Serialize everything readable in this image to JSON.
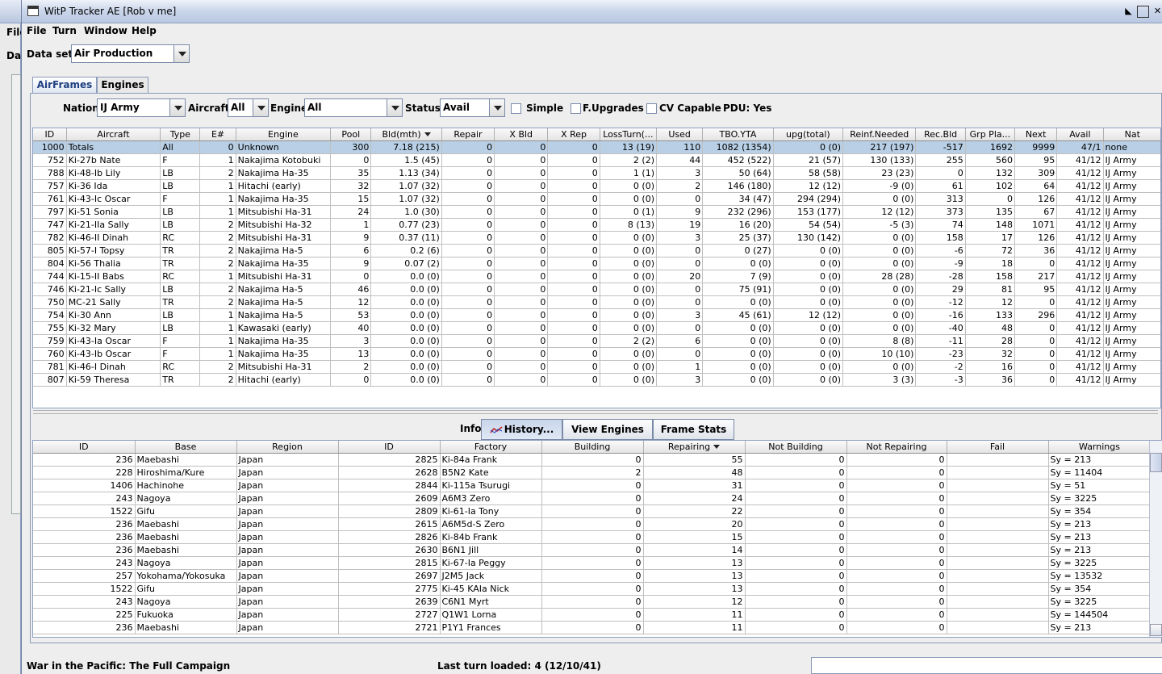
{
  "bg": {
    "menu": "File",
    "dataset": "Da"
  },
  "window": {
    "title": "WitP Tracker AE [Rob v me]"
  },
  "menu": [
    "File",
    "Turn",
    "Window",
    "Help"
  ],
  "dataset": {
    "label": "Data set:",
    "value": "Air Production"
  },
  "tabs": [
    "AirFrames",
    "Engines"
  ],
  "filters": {
    "nation_label": "Nation:",
    "nation": "IJ Army",
    "aircraft_label": "Aircraft:",
    "aircraft": "All",
    "engine_label": "Engine:",
    "engine": "All",
    "status_label": "Status:",
    "status": "Avail",
    "simple": "Simple",
    "fupgrades": "F.Upgrades",
    "cv": "CV Capable",
    "pdu": "PDU: Yes"
  },
  "frames": {
    "columns": [
      "ID",
      "Aircraft",
      "Type",
      "E#",
      "Engine",
      "Pool",
      "Bld(mth)",
      "Repair",
      "X Bld",
      "X Rep",
      "LossTurn(...",
      "Used",
      "TBO.YTA",
      "upg(total)",
      "Reinf.Needed",
      "Rec.Bld",
      "Grp Pla...",
      "Next",
      "Avail",
      "Nat"
    ],
    "rows": [
      [
        "1000",
        "Totals",
        "All",
        "0",
        "Unknown",
        "300",
        "7.18 (215)",
        "0",
        "0",
        "0",
        "13 (19)",
        "110",
        "1082 (1354)",
        "0 (0)",
        "217 (197)",
        "-517",
        "1692",
        "9999",
        "47/1",
        "none"
      ],
      [
        "752",
        "Ki-27b Nate",
        "F",
        "1",
        "Nakajima Kotobuki",
        "0",
        "1.5 (45)",
        "0",
        "0",
        "0",
        "2 (2)",
        "44",
        "452 (522)",
        "21 (57)",
        "130 (133)",
        "255",
        "560",
        "95",
        "41/12",
        "IJ Army"
      ],
      [
        "788",
        "Ki-48-Ib Lily",
        "LB",
        "2",
        "Nakajima Ha-35",
        "35",
        "1.13 (34)",
        "0",
        "0",
        "0",
        "1 (1)",
        "3",
        "50 (64)",
        "58 (58)",
        "23 (23)",
        "0",
        "132",
        "309",
        "41/12",
        "IJ Army"
      ],
      [
        "757",
        "Ki-36 Ida",
        "LB",
        "1",
        "Hitachi (early)",
        "32",
        "1.07 (32)",
        "0",
        "0",
        "0",
        "0 (0)",
        "2",
        "146 (180)",
        "12 (12)",
        "-9 (0)",
        "61",
        "102",
        "64",
        "41/12",
        "IJ Army"
      ],
      [
        "761",
        "Ki-43-Ic Oscar",
        "F",
        "1",
        "Nakajima Ha-35",
        "15",
        "1.07 (32)",
        "0",
        "0",
        "0",
        "0 (0)",
        "0",
        "34 (47)",
        "294 (294)",
        "0 (0)",
        "313",
        "0",
        "126",
        "41/12",
        "IJ Army"
      ],
      [
        "797",
        "Ki-51 Sonia",
        "LB",
        "1",
        "Mitsubishi Ha-31",
        "24",
        "1.0 (30)",
        "0",
        "0",
        "0",
        "0 (1)",
        "9",
        "232 (296)",
        "153 (177)",
        "12 (12)",
        "373",
        "135",
        "67",
        "41/12",
        "IJ Army"
      ],
      [
        "747",
        "Ki-21-IIa Sally",
        "LB",
        "2",
        "Mitsubishi Ha-32",
        "1",
        "0.77 (23)",
        "0",
        "0",
        "0",
        "8 (13)",
        "19",
        "16 (20)",
        "54 (54)",
        "-5 (3)",
        "74",
        "148",
        "1071",
        "41/12",
        "IJ Army"
      ],
      [
        "782",
        "Ki-46-II Dinah",
        "RC",
        "2",
        "Mitsubishi Ha-31",
        "9",
        "0.37 (11)",
        "0",
        "0",
        "0",
        "0 (0)",
        "3",
        "25 (37)",
        "130 (142)",
        "0 (0)",
        "158",
        "17",
        "126",
        "41/12",
        "IJ Army"
      ],
      [
        "805",
        "Ki-57-I Topsy",
        "TR",
        "2",
        "Nakajima Ha-5",
        "6",
        "0.2 (6)",
        "0",
        "0",
        "0",
        "0 (0)",
        "0",
        "0 (27)",
        "0 (0)",
        "0 (0)",
        "-6",
        "72",
        "36",
        "41/12",
        "IJ Army"
      ],
      [
        "804",
        "Ki-56 Thalia",
        "TR",
        "2",
        "Nakajima Ha-35",
        "9",
        "0.07 (2)",
        "0",
        "0",
        "0",
        "0 (0)",
        "0",
        "0 (0)",
        "0 (0)",
        "0 (0)",
        "-9",
        "18",
        "0",
        "41/12",
        "IJ Army"
      ],
      [
        "744",
        "Ki-15-II Babs",
        "RC",
        "1",
        "Mitsubishi Ha-31",
        "0",
        "0.0 (0)",
        "0",
        "0",
        "0",
        "0 (0)",
        "20",
        "7 (9)",
        "0 (0)",
        "28 (28)",
        "-28",
        "158",
        "217",
        "41/12",
        "IJ Army"
      ],
      [
        "746",
        "Ki-21-Ic Sally",
        "LB",
        "2",
        "Nakajima Ha-5",
        "46",
        "0.0 (0)",
        "0",
        "0",
        "0",
        "0 (0)",
        "0",
        "75 (91)",
        "0 (0)",
        "0 (0)",
        "29",
        "81",
        "95",
        "41/12",
        "IJ Army"
      ],
      [
        "750",
        "MC-21 Sally",
        "TR",
        "2",
        "Nakajima Ha-5",
        "12",
        "0.0 (0)",
        "0",
        "0",
        "0",
        "0 (0)",
        "0",
        "0 (0)",
        "0 (0)",
        "0 (0)",
        "-12",
        "12",
        "0",
        "41/12",
        "IJ Army"
      ],
      [
        "754",
        "Ki-30 Ann",
        "LB",
        "1",
        "Nakajima Ha-5",
        "53",
        "0.0 (0)",
        "0",
        "0",
        "0",
        "0 (0)",
        "3",
        "45 (61)",
        "12 (12)",
        "0 (0)",
        "-16",
        "133",
        "296",
        "41/12",
        "IJ Army"
      ],
      [
        "755",
        "Ki-32 Mary",
        "LB",
        "1",
        "Kawasaki (early)",
        "40",
        "0.0 (0)",
        "0",
        "0",
        "0",
        "0 (0)",
        "0",
        "0 (0)",
        "0 (0)",
        "0 (0)",
        "-40",
        "48",
        "0",
        "41/12",
        "IJ Army"
      ],
      [
        "759",
        "Ki-43-Ia Oscar",
        "F",
        "1",
        "Nakajima Ha-35",
        "3",
        "0.0 (0)",
        "0",
        "0",
        "0",
        "2 (2)",
        "6",
        "0 (0)",
        "0 (0)",
        "8 (8)",
        "-11",
        "28",
        "0",
        "41/12",
        "IJ Army"
      ],
      [
        "760",
        "Ki-43-Ib Oscar",
        "F",
        "1",
        "Nakajima Ha-35",
        "13",
        "0.0 (0)",
        "0",
        "0",
        "0",
        "0 (0)",
        "0",
        "0 (0)",
        "0 (0)",
        "10 (10)",
        "-23",
        "32",
        "0",
        "41/12",
        "IJ Army"
      ],
      [
        "781",
        "Ki-46-I Dinah",
        "RC",
        "2",
        "Mitsubishi Ha-31",
        "2",
        "0.0 (0)",
        "0",
        "0",
        "0",
        "0 (0)",
        "1",
        "0 (0)",
        "0 (0)",
        "0 (0)",
        "-2",
        "16",
        "0",
        "41/12",
        "IJ Army"
      ],
      [
        "807",
        "Ki-59 Theresa",
        "TR",
        "2",
        "Hitachi (early)",
        "0",
        "0.0 (0)",
        "0",
        "0",
        "0",
        "0 (0)",
        "3",
        "0 (0)",
        "0 (0)",
        "3 (3)",
        "-3",
        "36",
        "0",
        "41/12",
        "IJ Army"
      ]
    ]
  },
  "info": {
    "label": "Info:",
    "history": "History...",
    "engines": "View Engines",
    "stats": "Frame Stats"
  },
  "factories": {
    "columns": [
      "ID",
      "Base",
      "Region",
      "ID",
      "Factory",
      "Building",
      "Repairing",
      "Not Building",
      "Not Repairing",
      "Fail",
      "Warnings"
    ],
    "rows": [
      [
        "236",
        "Maebashi",
        "Japan",
        "2825",
        "Ki-84a Frank",
        "0",
        "55",
        "0",
        "0",
        "",
        "Sy = 213"
      ],
      [
        "228",
        "Hiroshima/Kure",
        "Japan",
        "2628",
        "B5N2 Kate",
        "2",
        "48",
        "0",
        "0",
        "",
        "Sy = 11404"
      ],
      [
        "1406",
        "Hachinohe",
        "Japan",
        "2844",
        "Ki-115a Tsurugi",
        "0",
        "31",
        "0",
        "0",
        "",
        "Sy = 51"
      ],
      [
        "243",
        "Nagoya",
        "Japan",
        "2609",
        "A6M3 Zero",
        "0",
        "24",
        "0",
        "0",
        "",
        "Sy = 3225"
      ],
      [
        "1522",
        "Gifu",
        "Japan",
        "2809",
        "Ki-61-Ia Tony",
        "0",
        "22",
        "0",
        "0",
        "",
        "Sy = 354"
      ],
      [
        "236",
        "Maebashi",
        "Japan",
        "2615",
        "A6M5d-S Zero",
        "0",
        "20",
        "0",
        "0",
        "",
        "Sy = 213"
      ],
      [
        "236",
        "Maebashi",
        "Japan",
        "2826",
        "Ki-84b Frank",
        "0",
        "15",
        "0",
        "0",
        "",
        "Sy = 213"
      ],
      [
        "236",
        "Maebashi",
        "Japan",
        "2630",
        "B6N1 Jill",
        "0",
        "14",
        "0",
        "0",
        "",
        "Sy = 213"
      ],
      [
        "243",
        "Nagoya",
        "Japan",
        "2815",
        "Ki-67-Ia Peggy",
        "0",
        "13",
        "0",
        "0",
        "",
        "Sy = 3225"
      ],
      [
        "257",
        "Yokohama/Yokosuka",
        "Japan",
        "2697",
        "J2M5 Jack",
        "0",
        "13",
        "0",
        "0",
        "",
        "Sy = 13532"
      ],
      [
        "1522",
        "Gifu",
        "Japan",
        "2775",
        "Ki-45 KAIa Nick",
        "0",
        "13",
        "0",
        "0",
        "",
        "Sy = 354"
      ],
      [
        "243",
        "Nagoya",
        "Japan",
        "2639",
        "C6N1 Myrt",
        "0",
        "12",
        "0",
        "0",
        "",
        "Sy = 3225"
      ],
      [
        "225",
        "Fukuoka",
        "Japan",
        "2727",
        "Q1W1 Lorna",
        "0",
        "11",
        "0",
        "0",
        "",
        "Sy = 144504"
      ],
      [
        "236",
        "Maebashi",
        "Japan",
        "2721",
        "P1Y1 Frances",
        "0",
        "11",
        "0",
        "0",
        "",
        "Sy = 213"
      ]
    ]
  },
  "status": {
    "left": "War in the Pacific: The Full Campaign",
    "middle": "Last turn loaded: 4 (12/10/41)"
  }
}
